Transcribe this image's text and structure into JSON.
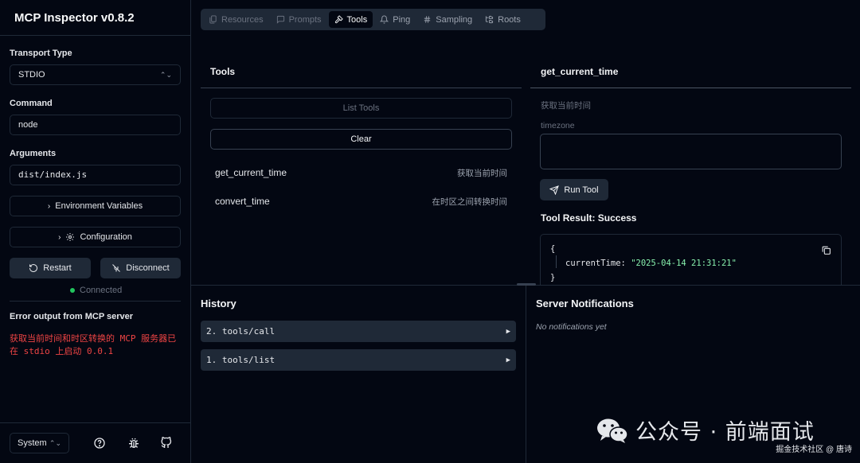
{
  "app": {
    "title": "MCP Inspector v0.8.2"
  },
  "sidebar": {
    "transport_label": "Transport Type",
    "transport_value": "STDIO",
    "command_label": "Command",
    "command_value": "node",
    "arguments_label": "Arguments",
    "arguments_value": "dist/index.js",
    "env_button": "Environment Variables",
    "config_button": "Configuration",
    "restart_button": "Restart",
    "disconnect_button": "Disconnect",
    "status": "Connected",
    "error_title": "Error output from MCP server",
    "error_text": "获取当前时间和时区转换的 MCP 服务器已在 stdio 上启动 0.0.1",
    "theme_value": "System"
  },
  "tabs": [
    {
      "label": "Resources",
      "icon": "files-icon"
    },
    {
      "label": "Prompts",
      "icon": "message-icon"
    },
    {
      "label": "Tools",
      "icon": "hammer-icon"
    },
    {
      "label": "Ping",
      "icon": "bell-icon"
    },
    {
      "label": "Sampling",
      "icon": "hash-icon"
    },
    {
      "label": "Roots",
      "icon": "folder-tree-icon"
    }
  ],
  "tools_panel": {
    "title": "Tools",
    "list_button": "List Tools",
    "clear_button": "Clear",
    "items": [
      {
        "name": "get_current_time",
        "description": "获取当前时间"
      },
      {
        "name": "convert_time",
        "description": "在时区之间转换时间"
      }
    ]
  },
  "tool_detail": {
    "title": "get_current_time",
    "description": "获取当前时间",
    "param_label": "timezone",
    "run_button": "Run Tool",
    "result_title": "Tool Result: Success",
    "result_open": "{",
    "result_key": "currentTime:",
    "result_value": "\"2025-04-14 21:31:21\"",
    "result_close": "}"
  },
  "history": {
    "title": "History",
    "items": [
      {
        "label": "2. tools/call"
      },
      {
        "label": "1. tools/list"
      }
    ]
  },
  "notifications": {
    "title": "Server Notifications",
    "empty": "No notifications yet"
  },
  "watermark": {
    "text": "公众号 · 前端面试",
    "small": "掘金技术社区 @ 唐诗"
  },
  "colors": {
    "background": "#030712",
    "surface": "#1f2937",
    "success_dot": "#22c55e",
    "error_text": "#ef4444",
    "json_string": "#86efac"
  }
}
